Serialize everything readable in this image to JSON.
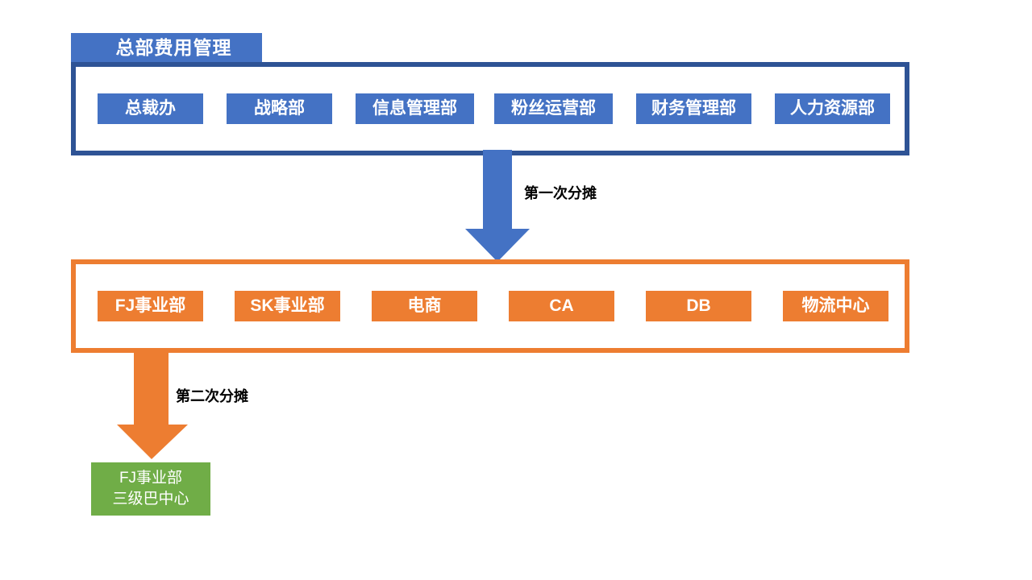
{
  "diagram": {
    "title_tab": {
      "label": "总部费用管理",
      "color": "#4472C4"
    },
    "levels": [
      {
        "id": "headquarters",
        "border_color": "#2E5395",
        "node_color": "#4472C4",
        "nodes": [
          {
            "label": "总裁办"
          },
          {
            "label": "战略部"
          },
          {
            "label": "信息管理部"
          },
          {
            "label": "粉丝运营部"
          },
          {
            "label": "财务管理部"
          },
          {
            "label": "人力资源部"
          }
        ]
      },
      {
        "id": "business-units",
        "border_color": "#ED7D31",
        "node_color": "#ED7D31",
        "nodes": [
          {
            "label": "FJ事业部"
          },
          {
            "label": "SK事业部"
          },
          {
            "label": "电商"
          },
          {
            "label": "CA"
          },
          {
            "label": "DB"
          },
          {
            "label": "物流中心"
          }
        ]
      }
    ],
    "arrows": [
      {
        "id": "first-allocation",
        "label": "第一次分摊",
        "color": "#4472C4",
        "direction": "down"
      },
      {
        "id": "second-allocation",
        "label": "第二次分摊",
        "color": "#ED7D31",
        "direction": "down"
      }
    ],
    "leaf_node": {
      "color": "#70AD47",
      "line1": "FJ事业部",
      "line2": "三级巴中心"
    }
  }
}
